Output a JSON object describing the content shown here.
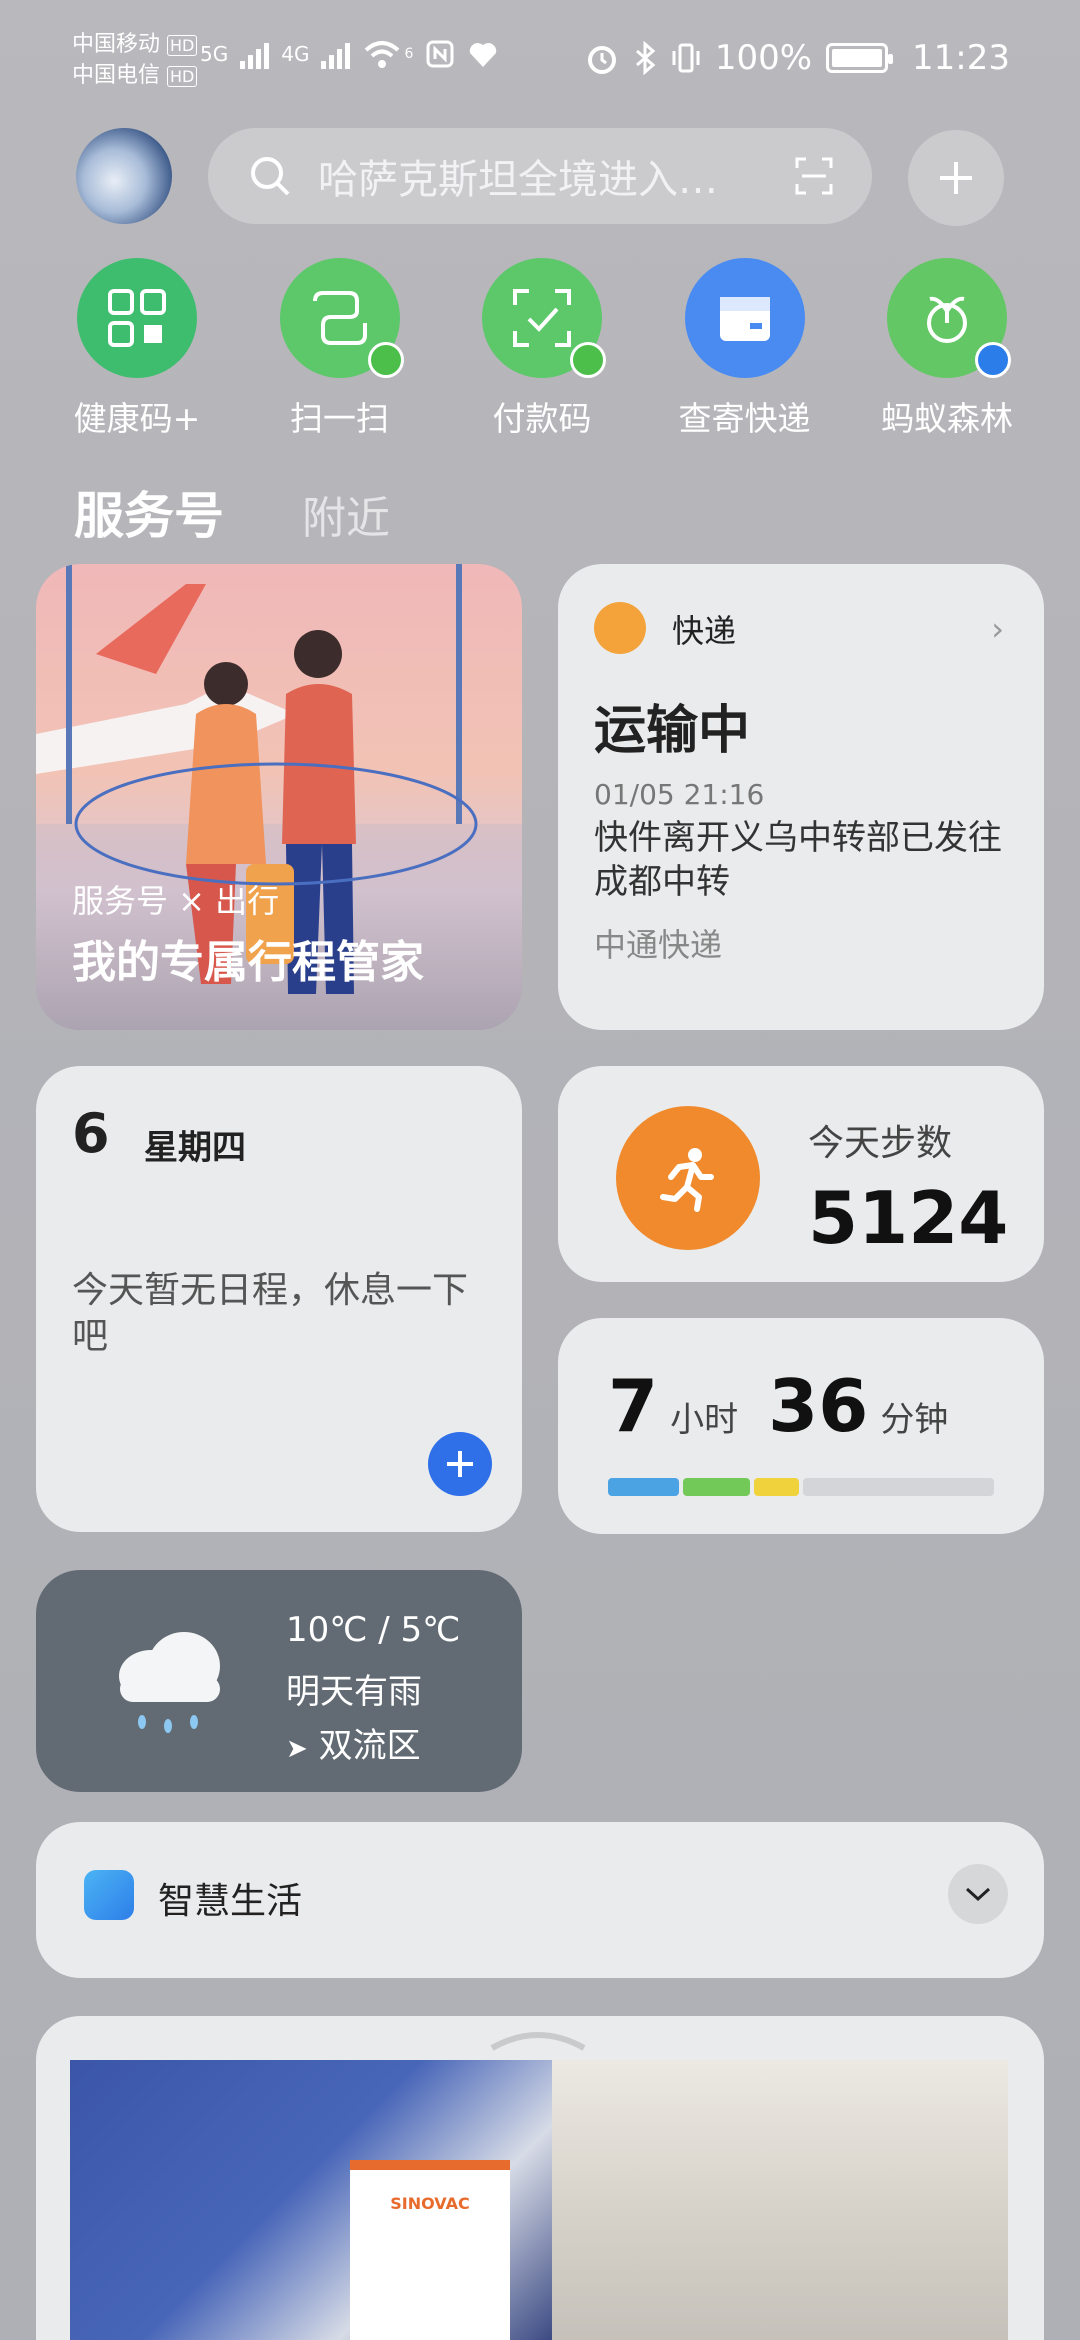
{
  "status_bar": {
    "carrier1": "中国移动",
    "carrier2": "中国电信",
    "hd": "HD",
    "net1": "5G",
    "net2": "4G",
    "wifi_gen": "6",
    "battery": "100%",
    "time": "11:23"
  },
  "search": {
    "placeholder": "哈萨克斯坦全境进入…"
  },
  "shortcuts": [
    {
      "label": "健康码+",
      "color": "#3fbd6f",
      "icon": "health-code-icon"
    },
    {
      "label": "扫一扫",
      "color": "#5cc86a",
      "icon": "scan-icon"
    },
    {
      "label": "付款码",
      "color": "#5cc86a",
      "icon": "payment-code-icon"
    },
    {
      "label": "查寄快递",
      "color": "#4a8bf2",
      "icon": "package-icon"
    },
    {
      "label": "蚂蚁森林",
      "color": "#64c766",
      "icon": "sprout-icon"
    }
  ],
  "tabs": {
    "main": "服务号",
    "nearby": "附近"
  },
  "travel_card": {
    "caption_top": "服务号 × 出行",
    "caption_main": "我的专属行程管家"
  },
  "express_card": {
    "title": "快递",
    "status": "运输中",
    "time": "01/05 21:16",
    "description": "快件离开义乌中转部已发往成都中转",
    "carrier": "中通快递"
  },
  "calendar_card": {
    "day": "6",
    "weekday": "星期四",
    "note": "今天暂无日程，休息一下吧"
  },
  "steps_card": {
    "label": "今天步数",
    "count": "5124"
  },
  "sleep_card": {
    "hours": "7",
    "hours_unit": "小时",
    "minutes": "36",
    "minutes_unit": "分钟",
    "segments": [
      {
        "color": "#4ba3e3",
        "share": 0.19
      },
      {
        "color": "#72c957",
        "share": 0.18
      },
      {
        "color": "#f0d23c",
        "share": 0.12
      },
      {
        "color": "#d4d5d8",
        "share": 0.51
      }
    ]
  },
  "weather_card": {
    "temp": "10℃ / 5℃",
    "condition": "明天有雨",
    "location": "双流区"
  },
  "smart_life": {
    "title": "智慧生活"
  },
  "news": {
    "brand": "SINOVAC"
  }
}
